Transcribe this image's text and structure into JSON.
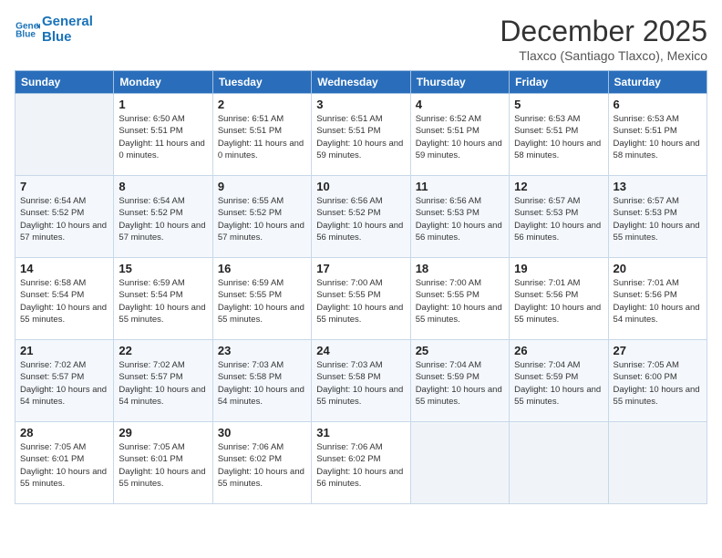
{
  "logo": {
    "line1": "General",
    "line2": "Blue"
  },
  "title": "December 2025",
  "subtitle": "Tlaxco (Santiago Tlaxco), Mexico",
  "days_of_week": [
    "Sunday",
    "Monday",
    "Tuesday",
    "Wednesday",
    "Thursday",
    "Friday",
    "Saturday"
  ],
  "weeks": [
    [
      {
        "num": "",
        "empty": true
      },
      {
        "num": "1",
        "sunrise": "6:50 AM",
        "sunset": "5:51 PM",
        "daylight": "11 hours and 0 minutes."
      },
      {
        "num": "2",
        "sunrise": "6:51 AM",
        "sunset": "5:51 PM",
        "daylight": "11 hours and 0 minutes."
      },
      {
        "num": "3",
        "sunrise": "6:51 AM",
        "sunset": "5:51 PM",
        "daylight": "10 hours and 59 minutes."
      },
      {
        "num": "4",
        "sunrise": "6:52 AM",
        "sunset": "5:51 PM",
        "daylight": "10 hours and 59 minutes."
      },
      {
        "num": "5",
        "sunrise": "6:53 AM",
        "sunset": "5:51 PM",
        "daylight": "10 hours and 58 minutes."
      },
      {
        "num": "6",
        "sunrise": "6:53 AM",
        "sunset": "5:51 PM",
        "daylight": "10 hours and 58 minutes."
      }
    ],
    [
      {
        "num": "7",
        "sunrise": "6:54 AM",
        "sunset": "5:52 PM",
        "daylight": "10 hours and 57 minutes."
      },
      {
        "num": "8",
        "sunrise": "6:54 AM",
        "sunset": "5:52 PM",
        "daylight": "10 hours and 57 minutes."
      },
      {
        "num": "9",
        "sunrise": "6:55 AM",
        "sunset": "5:52 PM",
        "daylight": "10 hours and 57 minutes."
      },
      {
        "num": "10",
        "sunrise": "6:56 AM",
        "sunset": "5:52 PM",
        "daylight": "10 hours and 56 minutes."
      },
      {
        "num": "11",
        "sunrise": "6:56 AM",
        "sunset": "5:53 PM",
        "daylight": "10 hours and 56 minutes."
      },
      {
        "num": "12",
        "sunrise": "6:57 AM",
        "sunset": "5:53 PM",
        "daylight": "10 hours and 56 minutes."
      },
      {
        "num": "13",
        "sunrise": "6:57 AM",
        "sunset": "5:53 PM",
        "daylight": "10 hours and 55 minutes."
      }
    ],
    [
      {
        "num": "14",
        "sunrise": "6:58 AM",
        "sunset": "5:54 PM",
        "daylight": "10 hours and 55 minutes."
      },
      {
        "num": "15",
        "sunrise": "6:59 AM",
        "sunset": "5:54 PM",
        "daylight": "10 hours and 55 minutes."
      },
      {
        "num": "16",
        "sunrise": "6:59 AM",
        "sunset": "5:55 PM",
        "daylight": "10 hours and 55 minutes."
      },
      {
        "num": "17",
        "sunrise": "7:00 AM",
        "sunset": "5:55 PM",
        "daylight": "10 hours and 55 minutes."
      },
      {
        "num": "18",
        "sunrise": "7:00 AM",
        "sunset": "5:55 PM",
        "daylight": "10 hours and 55 minutes."
      },
      {
        "num": "19",
        "sunrise": "7:01 AM",
        "sunset": "5:56 PM",
        "daylight": "10 hours and 55 minutes."
      },
      {
        "num": "20",
        "sunrise": "7:01 AM",
        "sunset": "5:56 PM",
        "daylight": "10 hours and 54 minutes."
      }
    ],
    [
      {
        "num": "21",
        "sunrise": "7:02 AM",
        "sunset": "5:57 PM",
        "daylight": "10 hours and 54 minutes."
      },
      {
        "num": "22",
        "sunrise": "7:02 AM",
        "sunset": "5:57 PM",
        "daylight": "10 hours and 54 minutes."
      },
      {
        "num": "23",
        "sunrise": "7:03 AM",
        "sunset": "5:58 PM",
        "daylight": "10 hours and 54 minutes."
      },
      {
        "num": "24",
        "sunrise": "7:03 AM",
        "sunset": "5:58 PM",
        "daylight": "10 hours and 55 minutes."
      },
      {
        "num": "25",
        "sunrise": "7:04 AM",
        "sunset": "5:59 PM",
        "daylight": "10 hours and 55 minutes."
      },
      {
        "num": "26",
        "sunrise": "7:04 AM",
        "sunset": "5:59 PM",
        "daylight": "10 hours and 55 minutes."
      },
      {
        "num": "27",
        "sunrise": "7:05 AM",
        "sunset": "6:00 PM",
        "daylight": "10 hours and 55 minutes."
      }
    ],
    [
      {
        "num": "28",
        "sunrise": "7:05 AM",
        "sunset": "6:01 PM",
        "daylight": "10 hours and 55 minutes."
      },
      {
        "num": "29",
        "sunrise": "7:05 AM",
        "sunset": "6:01 PM",
        "daylight": "10 hours and 55 minutes."
      },
      {
        "num": "30",
        "sunrise": "7:06 AM",
        "sunset": "6:02 PM",
        "daylight": "10 hours and 55 minutes."
      },
      {
        "num": "31",
        "sunrise": "7:06 AM",
        "sunset": "6:02 PM",
        "daylight": "10 hours and 56 minutes."
      },
      {
        "num": "",
        "empty": true
      },
      {
        "num": "",
        "empty": true
      },
      {
        "num": "",
        "empty": true
      }
    ]
  ]
}
